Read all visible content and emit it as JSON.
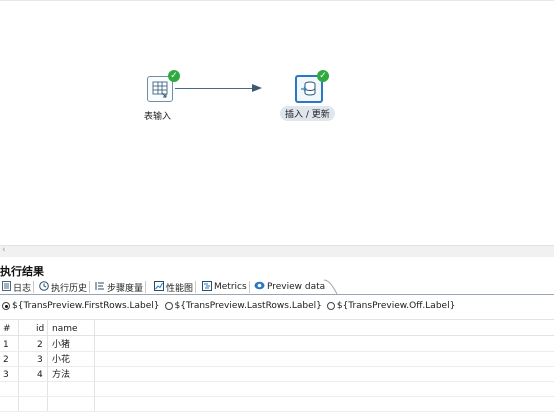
{
  "canvas": {
    "steps": [
      {
        "label": "表输入",
        "status": "success",
        "icon": "table-input-icon"
      },
      {
        "label": "插入 / 更新",
        "status": "success",
        "icon": "insert-update-icon"
      }
    ]
  },
  "results": {
    "title": "执行结果",
    "tabs": [
      {
        "label": "日志",
        "icon": "log-icon"
      },
      {
        "label": "执行历史",
        "icon": "history-icon"
      },
      {
        "label": "步骤度量",
        "icon": "step-metrics-icon"
      },
      {
        "label": "性能图",
        "icon": "performance-graph-icon"
      },
      {
        "label": "Metrics",
        "icon": "metrics-icon"
      },
      {
        "label": "Preview data",
        "icon": "preview-eye-icon",
        "active": true
      }
    ],
    "radios": [
      {
        "label": "${TransPreview.FirstRows.Label}",
        "checked": true
      },
      {
        "label": "${TransPreview.LastRows.Label}",
        "checked": false
      },
      {
        "label": "${TransPreview.Off.Label}",
        "checked": false
      }
    ],
    "table": {
      "columns": [
        "#",
        "id",
        "name"
      ],
      "rows": [
        [
          "1",
          "2",
          "小猪"
        ],
        [
          "2",
          "3",
          "小花"
        ],
        [
          "3",
          "4",
          "方法"
        ]
      ]
    }
  }
}
